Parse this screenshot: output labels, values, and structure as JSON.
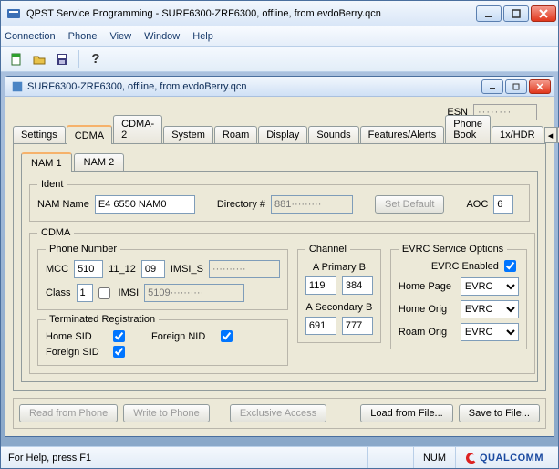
{
  "window": {
    "title": "QPST Service Programming - SURF6300-ZRF6300, offline, from evdoBerry.qcn"
  },
  "menu": {
    "connection": "Connection",
    "phone": "Phone",
    "view": "View",
    "window": "Window",
    "help": "Help"
  },
  "toolbar": {
    "new": "new",
    "open": "open",
    "save": "save",
    "help": "help"
  },
  "doc": {
    "title": "SURF6300-ZRF6300, offline, from evdoBerry.qcn"
  },
  "esn": {
    "label": "ESN",
    "value": "········"
  },
  "main_tabs": {
    "settings": "Settings",
    "cdma": "CDMA",
    "cdma2": "CDMA-2",
    "system": "System",
    "roam": "Roam",
    "display": "Display",
    "sounds": "Sounds",
    "features": "Features/Alerts",
    "phonebook": "Phone Book",
    "hdr": "1x/HDR"
  },
  "nam_tabs": {
    "nam1": "NAM 1",
    "nam2": "NAM 2"
  },
  "ident": {
    "legend": "Ident",
    "nam_name_label": "NAM Name",
    "nam_name_value": "E4 6550 NAM0",
    "dir_label": "Directory #",
    "dir_value": "881·········",
    "set_default": "Set Default",
    "aoc_label": "AOC",
    "aoc_value": "6"
  },
  "cdma": {
    "legend": "CDMA",
    "phone_legend": "Phone Number",
    "mcc_label": "MCC",
    "mcc_value": "510",
    "m1112_label": "11_12",
    "m1112_value": "09",
    "imsis_label": "IMSI_S",
    "imsis_value": "··········",
    "class_label": "Class",
    "class_value": "1",
    "imsi_label": "IMSI",
    "imsi_checked": false,
    "imsi_value": "5109··········",
    "term_legend": "Terminated Registration",
    "home_sid_label": "Home SID",
    "home_sid_checked": true,
    "foreign_nid_label": "Foreign NID",
    "foreign_nid_checked": true,
    "foreign_sid_label": "Foreign SID",
    "foreign_sid_checked": true
  },
  "channel": {
    "legend": "Channel",
    "primary_label": "A  Primary  B",
    "primary_a": "119",
    "primary_b": "384",
    "secondary_label": "A  Secondary  B",
    "secondary_a": "691",
    "secondary_b": "777"
  },
  "evrc": {
    "legend": "EVRC Service Options",
    "enabled_label": "EVRC Enabled",
    "enabled_checked": true,
    "home_page_label": "Home Page",
    "home_page_value": "EVRC",
    "home_orig_label": "Home Orig",
    "home_orig_value": "EVRC",
    "roam_orig_label": "Roam Orig",
    "roam_orig_value": "EVRC"
  },
  "actions": {
    "read": "Read from Phone",
    "write": "Write to Phone",
    "exclusive": "Exclusive Access",
    "load": "Load from File...",
    "save": "Save to File..."
  },
  "status": {
    "help": "For Help, press F1",
    "num": "NUM",
    "brand": "QUALCOMM"
  },
  "colors": {
    "accent": "#1b4aa0"
  }
}
